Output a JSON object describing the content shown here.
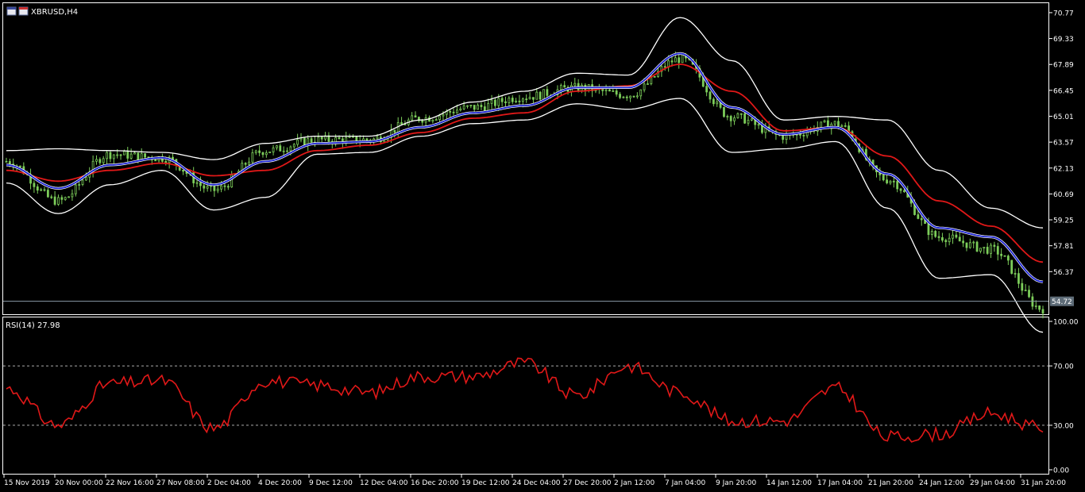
{
  "window": {
    "symbol_title": "XBRUSD,H4"
  },
  "price_axis": {
    "ticks": [
      "70.77",
      "69.33",
      "67.89",
      "66.45",
      "65.01",
      "63.57",
      "62.13",
      "60.69",
      "59.25",
      "57.81",
      "56.37"
    ],
    "current_price": "54.72"
  },
  "rsi_panel": {
    "label": "RSI(14) 27.98",
    "ticks": [
      "100.00",
      "70.00",
      "30.00",
      "0.00"
    ]
  },
  "time_axis": {
    "labels": [
      "15 Nov 2019",
      "20 Nov 00:00",
      "22 Nov 16:00",
      "27 Nov 08:00",
      "2 Dec 04:00",
      "4 Dec 20:00",
      "9 Dec 12:00",
      "12 Dec 04:00",
      "16 Dec 20:00",
      "19 Dec 12:00",
      "24 Dec 04:00",
      "27 Dec 20:00",
      "2 Jan 12:00",
      "7 Jan 04:00",
      "9 Jan 20:00",
      "14 Jan 12:00",
      "17 Jan 04:00",
      "21 Jan 20:00",
      "24 Jan 12:00",
      "29 Jan 04:00",
      "31 Jan 20:00"
    ]
  },
  "colors": {
    "background": "#000000",
    "frame": "#ffffff",
    "candles": "#7ccd5a",
    "bollinger": "#ffffff",
    "ma_fast": "#1a22d0",
    "ma_slow": "#e01818",
    "rsi": "#e01818",
    "price_line": "#8a9aa8"
  },
  "chart_data": [
    {
      "type": "line",
      "title": "XBRUSD,H4",
      "x": [
        "15 Nov 2019",
        "20 Nov 00:00",
        "22 Nov 16:00",
        "27 Nov 08:00",
        "2 Dec 04:00",
        "4 Dec 20:00",
        "9 Dec 12:00",
        "12 Dec 04:00",
        "16 Dec 20:00",
        "19 Dec 12:00",
        "24 Dec 04:00",
        "27 Dec 20:00",
        "2 Jan 12:00",
        "7 Jan 04:00",
        "9 Jan 20:00",
        "14 Jan 12:00",
        "17 Jan 04:00",
        "21 Jan 20:00",
        "24 Jan 12:00",
        "29 Jan 04:00",
        "31 Jan 20:00"
      ],
      "series": [
        {
          "values": [
            62.5,
            60.3,
            62.9,
            62.7,
            60.9,
            63.1,
            63.7,
            63.7,
            64.9,
            65.5,
            66.1,
            66.6,
            66.2,
            68.2,
            65.0,
            63.9,
            64.6,
            61.5,
            58.3,
            57.6,
            54.3
          ]
        },
        {
          "values": [
            62.3,
            61.0,
            62.3,
            62.7,
            61.2,
            62.5,
            63.5,
            63.6,
            64.4,
            65.2,
            65.6,
            66.6,
            66.6,
            68.5,
            65.5,
            64.0,
            64.4,
            61.8,
            58.8,
            58.3,
            55.8
          ]
        },
        {
          "values": [
            62.0,
            61.4,
            62.0,
            62.4,
            61.7,
            62.0,
            63.1,
            63.4,
            64.1,
            64.9,
            65.2,
            66.4,
            66.7,
            67.9,
            66.4,
            64.2,
            64.4,
            62.8,
            60.3,
            58.9,
            56.9
          ]
        },
        {
          "values": [
            63.1,
            63.2,
            63.1,
            63.0,
            62.6,
            63.5,
            63.9,
            63.9,
            64.8,
            65.8,
            66.4,
            67.4,
            67.3,
            70.5,
            68.1,
            64.8,
            65.0,
            64.8,
            62.0,
            59.9,
            58.8
          ]
        },
        {
          "values": [
            61.3,
            59.6,
            61.2,
            62.0,
            59.8,
            60.5,
            62.9,
            63.0,
            63.9,
            64.6,
            64.8,
            65.7,
            65.4,
            66.0,
            63.0,
            63.2,
            63.6,
            59.9,
            56.0,
            56.2,
            53.0
          ]
        }
      ],
      "ylim": [
        54.0,
        70.9
      ]
    },
    {
      "type": "line",
      "title": "RSI(14) 27.98",
      "x": [
        "15 Nov 2019",
        "20 Nov 00:00",
        "22 Nov 16:00",
        "27 Nov 08:00",
        "2 Dec 04:00",
        "4 Dec 20:00",
        "9 Dec 12:00",
        "12 Dec 04:00",
        "16 Dec 20:00",
        "19 Dec 12:00",
        "24 Dec 04:00",
        "27 Dec 20:00",
        "2 Jan 12:00",
        "7 Jan 04:00",
        "9 Jan 20:00",
        "14 Jan 12:00",
        "17 Jan 04:00",
        "21 Jan 20:00",
        "24 Jan 12:00",
        "29 Jan 04:00",
        "31 Jan 20:00"
      ],
      "series": [
        {
          "values": [
            55,
            30,
            58,
            60,
            28,
            60,
            57,
            52,
            63,
            63,
            72,
            50,
            70,
            52,
            33,
            33,
            55,
            22,
            24,
            38,
            28
          ]
        }
      ],
      "reference_lines": [
        70,
        30
      ],
      "ylim": [
        0,
        100
      ]
    }
  ]
}
